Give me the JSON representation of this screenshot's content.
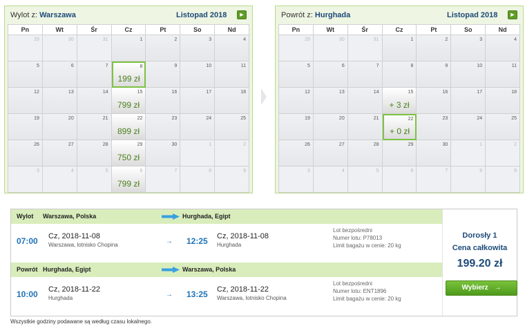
{
  "outbound_calendar": {
    "label": "Wylot z:",
    "city": "Warszawa",
    "month": "Listopad 2018",
    "next_icon": "arrow-right-icon",
    "weekdays": [
      "Pn",
      "Wt",
      "Śr",
      "Cz",
      "Pt",
      "So",
      "Nd"
    ],
    "weeks": [
      [
        {
          "d": "29",
          "o": true
        },
        {
          "d": "30",
          "o": true
        },
        {
          "d": "31",
          "o": true
        },
        {
          "d": "1"
        },
        {
          "d": "2"
        },
        {
          "d": "3"
        },
        {
          "d": "4"
        }
      ],
      [
        {
          "d": "5"
        },
        {
          "d": "6"
        },
        {
          "d": "7"
        },
        {
          "d": "8",
          "p": "199 zł",
          "s": true
        },
        {
          "d": "9"
        },
        {
          "d": "10"
        },
        {
          "d": "11"
        }
      ],
      [
        {
          "d": "12"
        },
        {
          "d": "13"
        },
        {
          "d": "14"
        },
        {
          "d": "15",
          "p": "799 zł"
        },
        {
          "d": "16"
        },
        {
          "d": "17"
        },
        {
          "d": "18"
        }
      ],
      [
        {
          "d": "19"
        },
        {
          "d": "20"
        },
        {
          "d": "21"
        },
        {
          "d": "22",
          "p": "899 zł"
        },
        {
          "d": "23"
        },
        {
          "d": "24"
        },
        {
          "d": "25"
        }
      ],
      [
        {
          "d": "26"
        },
        {
          "d": "27"
        },
        {
          "d": "28"
        },
        {
          "d": "29",
          "p": "750 zł"
        },
        {
          "d": "30"
        },
        {
          "d": "1",
          "o": true
        },
        {
          "d": "2",
          "o": true
        }
      ],
      [
        {
          "d": "3",
          "o": true
        },
        {
          "d": "4",
          "o": true
        },
        {
          "d": "5",
          "o": true
        },
        {
          "d": "6",
          "o": true,
          "p": "799 zł"
        },
        {
          "d": "7",
          "o": true
        },
        {
          "d": "8",
          "o": true
        },
        {
          "d": "9",
          "o": true
        }
      ]
    ]
  },
  "return_calendar": {
    "label": "Powrót z:",
    "city": "Hurghada",
    "month": "Listopad 2018",
    "next_icon": "arrow-right-icon",
    "weekdays": [
      "Pn",
      "Wt",
      "Śr",
      "Cz",
      "Pt",
      "So",
      "Nd"
    ],
    "weeks": [
      [
        {
          "d": "29",
          "o": true
        },
        {
          "d": "30",
          "o": true
        },
        {
          "d": "31",
          "o": true
        },
        {
          "d": "1"
        },
        {
          "d": "2"
        },
        {
          "d": "3"
        },
        {
          "d": "4"
        }
      ],
      [
        {
          "d": "5"
        },
        {
          "d": "6"
        },
        {
          "d": "7"
        },
        {
          "d": "8"
        },
        {
          "d": "9"
        },
        {
          "d": "10"
        },
        {
          "d": "11"
        }
      ],
      [
        {
          "d": "12"
        },
        {
          "d": "13"
        },
        {
          "d": "14"
        },
        {
          "d": "15",
          "p": "+ 3 zł"
        },
        {
          "d": "16"
        },
        {
          "d": "17"
        },
        {
          "d": "18"
        }
      ],
      [
        {
          "d": "19"
        },
        {
          "d": "20"
        },
        {
          "d": "21"
        },
        {
          "d": "22",
          "p": "+ 0 zł",
          "s": true
        },
        {
          "d": "23"
        },
        {
          "d": "24"
        },
        {
          "d": "25"
        }
      ],
      [
        {
          "d": "26"
        },
        {
          "d": "27"
        },
        {
          "d": "28"
        },
        {
          "d": "29"
        },
        {
          "d": "30"
        },
        {
          "d": "1",
          "o": true
        },
        {
          "d": "2",
          "o": true
        }
      ],
      [
        {
          "d": "3",
          "o": true
        },
        {
          "d": "4",
          "o": true
        },
        {
          "d": "5",
          "o": true
        },
        {
          "d": "6",
          "o": true
        },
        {
          "d": "7",
          "o": true
        },
        {
          "d": "8",
          "o": true
        },
        {
          "d": "9",
          "o": true
        }
      ]
    ]
  },
  "summary": {
    "outbound": {
      "kind": "Wylot",
      "from": "Warszawa, Polska",
      "to": "Hurghada, Egipt",
      "dep_time": "07:00",
      "dep_date": "Cz, 2018-11-08",
      "dep_place": "Warszawa, lotnisko Chopina",
      "arr_time": "12:25",
      "arr_date": "Cz, 2018-11-08",
      "arr_place": "Hurghada",
      "info1": "Lot bezpośredni",
      "info2": "Numer lotu: P78013",
      "info3": "Limit bagażu w cenie: 20 kg"
    },
    "return": {
      "kind": "Powrót",
      "from": "Hurghada, Egipt",
      "to": "Warszawa, Polska",
      "dep_time": "10:00",
      "dep_date": "Cz, 2018-11-22",
      "dep_place": "Hurghada",
      "arr_time": "13:25",
      "arr_date": "Cz, 2018-11-22",
      "arr_place": "Warszawa, lotnisko Chopina",
      "info1": "Lot bezpośredni",
      "info2": "Numer lotu: ENT1896",
      "info3": "Limit bagażu w cenie: 20 kg"
    },
    "arrow_glyph": "→",
    "price": {
      "passengers": "Dorosły 1",
      "total_label": "Cena całkowita",
      "total": "199.20 zł",
      "button_label": "Wybierz",
      "button_icon": "arrow-right-icon"
    }
  },
  "footnote": "Wszystkie godziny podawane są według czasu lokalnego.",
  "colors": {
    "accent_green": "#5f9c28",
    "price_green": "#4a7f1c",
    "selected_border": "#7cc242",
    "time_blue": "#1f72b8",
    "header_blue": "#1d4a7a",
    "segment_header_bg": "#d9edbc",
    "arrow_blue": "#3aa0e0"
  }
}
